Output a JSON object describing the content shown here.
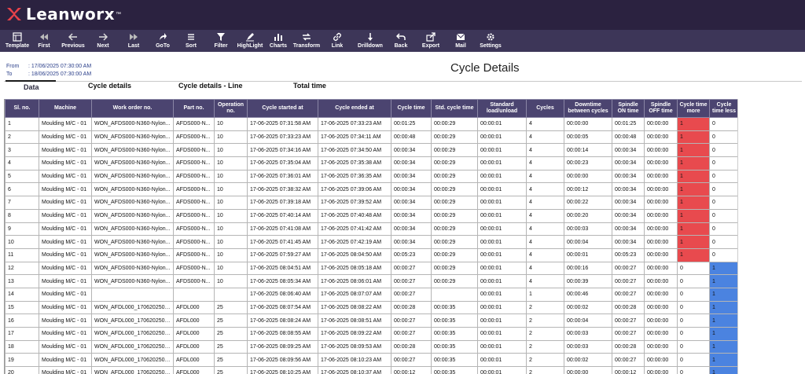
{
  "app": {
    "brand": "Leanworx",
    "trademark": "™",
    "colors": {
      "header": "#2b2240",
      "toolbar": "#3d3658",
      "table_header": "#4b4470",
      "cycle_more": "#e84a4e",
      "cycle_less": "#4b83e0",
      "logo_red": "#e8424a"
    }
  },
  "toolbar": [
    {
      "label": "Template",
      "icon": "template-icon"
    },
    {
      "label": "First",
      "icon": "first-icon"
    },
    {
      "label": "Previous",
      "icon": "previous-icon"
    },
    {
      "label": "Next",
      "icon": "next-icon"
    },
    {
      "label": "Last",
      "icon": "last-icon"
    },
    {
      "label": "GoTo",
      "icon": "goto-icon"
    },
    {
      "label": "Sort",
      "icon": "sort-icon"
    },
    {
      "label": "Filter",
      "icon": "filter-icon"
    },
    {
      "label": "HighLight",
      "icon": "highlight-icon"
    },
    {
      "label": "Charts",
      "icon": "charts-icon"
    },
    {
      "label": "Transform",
      "icon": "transform-icon"
    },
    {
      "label": "Link",
      "icon": "link-icon"
    },
    {
      "label": "Drilldown",
      "icon": "drilldown-icon"
    },
    {
      "label": "Back",
      "icon": "back-icon"
    },
    {
      "label": "Export",
      "icon": "export-icon"
    },
    {
      "label": "Mail",
      "icon": "mail-icon"
    },
    {
      "label": "Settings",
      "icon": "settings-icon"
    }
  ],
  "range": {
    "from_label": "From",
    "from_value": ": 17/06/2025 07:30:00 AM",
    "to_label": "To",
    "to_value": ": 18/06/2025 07:30:00 AM"
  },
  "page_title": "Cycle Details",
  "tabs": [
    "Data",
    "Cycle details",
    "Cycle details - Line",
    "Total time"
  ],
  "table": {
    "columns": [
      "Sl. no.",
      "Machine",
      "Work order no.",
      "Part no.",
      "Operation no.",
      "Cycle started at",
      "Cycle ended at",
      "Cycle time",
      "Std. cycle time",
      "Standard load/unload",
      "Cycles",
      "Downtime between cycles",
      "Spindle ON time",
      "Spindle OFF time",
      "Cycle time more",
      "Cycle time less"
    ],
    "rows": [
      [
        "1",
        "Moulding M/C - 01",
        "WON_AFDS000-N360-Nylon...",
        "AFDS000-N...",
        "10",
        "17-06-2025 07:31:58 AM",
        "17-06-2025 07:33:23 AM",
        "00:01:25",
        "00:00:29",
        "00:00:01",
        "4",
        "00:00:00",
        "00:01:25",
        "00:00:00",
        "1",
        "0"
      ],
      [
        "2",
        "Moulding M/C - 01",
        "WON_AFDS000-N360-Nylon...",
        "AFDS000-N...",
        "10",
        "17-06-2025 07:33:23 AM",
        "17-06-2025 07:34:11 AM",
        "00:00:48",
        "00:00:29",
        "00:00:01",
        "4",
        "00:00:05",
        "00:00:48",
        "00:00:00",
        "1",
        "0"
      ],
      [
        "3",
        "Moulding M/C - 01",
        "WON_AFDS000-N360-Nylon...",
        "AFDS000-N...",
        "10",
        "17-06-2025 07:34:16 AM",
        "17-06-2025 07:34:50 AM",
        "00:00:34",
        "00:00:29",
        "00:00:01",
        "4",
        "00:00:14",
        "00:00:34",
        "00:00:00",
        "1",
        "0"
      ],
      [
        "4",
        "Moulding M/C - 01",
        "WON_AFDS000-N360-Nylon...",
        "AFDS000-N...",
        "10",
        "17-06-2025 07:35:04 AM",
        "17-06-2025 07:35:38 AM",
        "00:00:34",
        "00:00:29",
        "00:00:01",
        "4",
        "00:00:23",
        "00:00:34",
        "00:00:00",
        "1",
        "0"
      ],
      [
        "5",
        "Moulding M/C - 01",
        "WON_AFDS000-N360-Nylon...",
        "AFDS000-N...",
        "10",
        "17-06-2025 07:36:01 AM",
        "17-06-2025 07:36:35 AM",
        "00:00:34",
        "00:00:29",
        "00:00:01",
        "4",
        "00:00:00",
        "00:00:34",
        "00:00:00",
        "1",
        "0"
      ],
      [
        "6",
        "Moulding M/C - 01",
        "WON_AFDS000-N360-Nylon...",
        "AFDS000-N...",
        "10",
        "17-06-2025 07:38:32 AM",
        "17-06-2025 07:39:06 AM",
        "00:00:34",
        "00:00:29",
        "00:00:01",
        "4",
        "00:00:12",
        "00:00:34",
        "00:00:00",
        "1",
        "0"
      ],
      [
        "7",
        "Moulding M/C - 01",
        "WON_AFDS000-N360-Nylon...",
        "AFDS000-N...",
        "10",
        "17-06-2025 07:39:18 AM",
        "17-06-2025 07:39:52 AM",
        "00:00:34",
        "00:00:29",
        "00:00:01",
        "4",
        "00:00:22",
        "00:00:34",
        "00:00:00",
        "1",
        "0"
      ],
      [
        "8",
        "Moulding M/C - 01",
        "WON_AFDS000-N360-Nylon...",
        "AFDS000-N...",
        "10",
        "17-06-2025 07:40:14 AM",
        "17-06-2025 07:40:48 AM",
        "00:00:34",
        "00:00:29",
        "00:00:01",
        "4",
        "00:00:20",
        "00:00:34",
        "00:00:00",
        "1",
        "0"
      ],
      [
        "9",
        "Moulding M/C - 01",
        "WON_AFDS000-N360-Nylon...",
        "AFDS000-N...",
        "10",
        "17-06-2025 07:41:08 AM",
        "17-06-2025 07:41:42 AM",
        "00:00:34",
        "00:00:29",
        "00:00:01",
        "4",
        "00:00:03",
        "00:00:34",
        "00:00:00",
        "1",
        "0"
      ],
      [
        "10",
        "Moulding M/C - 01",
        "WON_AFDS000-N360-Nylon...",
        "AFDS000-N...",
        "10",
        "17-06-2025 07:41:45 AM",
        "17-06-2025 07:42:19 AM",
        "00:00:34",
        "00:00:29",
        "00:00:01",
        "4",
        "00:00:04",
        "00:00:34",
        "00:00:00",
        "1",
        "0"
      ],
      [
        "11",
        "Moulding M/C - 01",
        "WON_AFDS000-N360-Nylon...",
        "AFDS000-N...",
        "10",
        "17-06-2025 07:59:27 AM",
        "17-06-2025 08:04:50 AM",
        "00:05:23",
        "00:00:29",
        "00:00:01",
        "4",
        "00:00:01",
        "00:05:23",
        "00:00:00",
        "1",
        "0"
      ],
      [
        "12",
        "Moulding M/C - 01",
        "WON_AFDS000-N360-Nylon...",
        "AFDS000-N...",
        "10",
        "17-06-2025 08:04:51 AM",
        "17-06-2025 08:05:18 AM",
        "00:00:27",
        "00:00:29",
        "00:00:01",
        "4",
        "00:00:16",
        "00:00:27",
        "00:00:00",
        "0",
        "1"
      ],
      [
        "13",
        "Moulding M/C - 01",
        "WON_AFDS000-N360-Nylon...",
        "AFDS000-N...",
        "10",
        "17-06-2025 08:05:34 AM",
        "17-06-2025 08:06:01 AM",
        "00:00:27",
        "00:00:29",
        "00:00:01",
        "4",
        "00:00:39",
        "00:00:27",
        "00:00:00",
        "0",
        "1"
      ],
      [
        "14",
        "Moulding M/C - 01",
        "",
        "",
        "",
        "17-06-2025 08:06:40 AM",
        "17-06-2025 08:07:07 AM",
        "00:00:27",
        "",
        "00:00:01",
        "1",
        "00:00:46",
        "00:00:27",
        "00:00:00",
        "0",
        "1"
      ],
      [
        "15",
        "Moulding M/C - 01",
        "WON_AFDL000_1706202508...",
        "AFDL000",
        "25",
        "17-06-2025 08:07:54 AM",
        "17-06-2025 08:08:22 AM",
        "00:00:28",
        "00:00:35",
        "00:00:01",
        "2",
        "00:00:02",
        "00:00:28",
        "00:00:00",
        "0",
        "1"
      ],
      [
        "16",
        "Moulding M/C - 01",
        "WON_AFDL000_1706202508...",
        "AFDL000",
        "25",
        "17-06-2025 08:08:24 AM",
        "17-06-2025 08:08:51 AM",
        "00:00:27",
        "00:00:35",
        "00:00:01",
        "2",
        "00:00:04",
        "00:00:27",
        "00:00:00",
        "0",
        "1"
      ],
      [
        "17",
        "Moulding M/C - 01",
        "WON_AFDL000_1706202508...",
        "AFDL000",
        "25",
        "17-06-2025 08:08:55 AM",
        "17-06-2025 08:09:22 AM",
        "00:00:27",
        "00:00:35",
        "00:00:01",
        "2",
        "00:00:03",
        "00:00:27",
        "00:00:00",
        "0",
        "1"
      ],
      [
        "18",
        "Moulding M/C - 01",
        "WON_AFDL000_1706202508...",
        "AFDL000",
        "25",
        "17-06-2025 08:09:25 AM",
        "17-06-2025 08:09:53 AM",
        "00:00:28",
        "00:00:35",
        "00:00:01",
        "2",
        "00:00:03",
        "00:00:28",
        "00:00:00",
        "0",
        "1"
      ],
      [
        "19",
        "Moulding M/C - 01",
        "WON_AFDL000_1706202508...",
        "AFDL000",
        "25",
        "17-06-2025 08:09:56 AM",
        "17-06-2025 08:10:23 AM",
        "00:00:27",
        "00:00:35",
        "00:00:01",
        "2",
        "00:00:02",
        "00:00:27",
        "00:00:00",
        "0",
        "1"
      ],
      [
        "20",
        "Moulding M/C - 01",
        "WON_AFDL000_1706202508...",
        "AFDL000",
        "25",
        "17-06-2025 08:10:25 AM",
        "17-06-2025 08:10:37 AM",
        "00:00:12",
        "00:00:35",
        "00:00:01",
        "2",
        "00:00:00",
        "00:00:12",
        "00:00:00",
        "0",
        "1"
      ]
    ]
  }
}
